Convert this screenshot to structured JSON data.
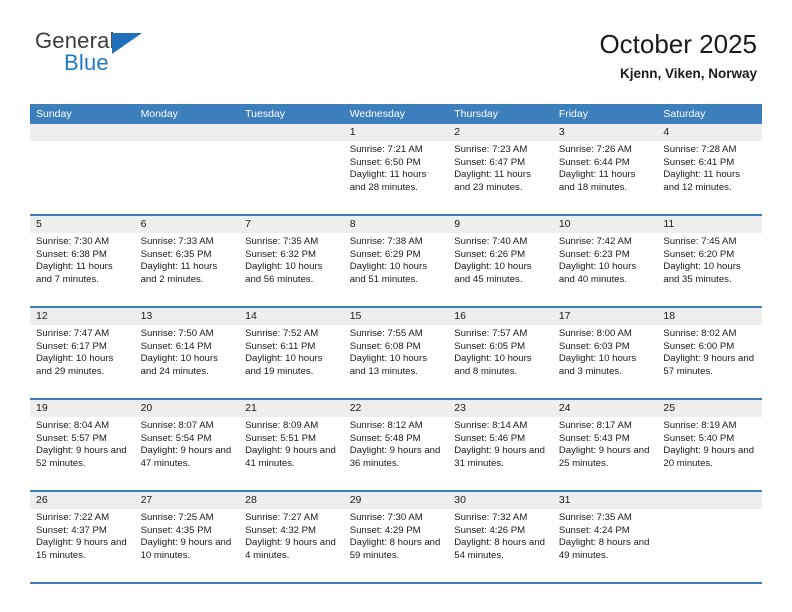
{
  "brand": {
    "name_top": "General",
    "name_bottom": "Blue",
    "triangle_color": "#1f6fbb",
    "top_color": "#3c3c3c",
    "bottom_color": "#1f7ac4"
  },
  "header": {
    "title": "October 2025",
    "location": "Kjenn, Viken, Norway"
  },
  "theme": {
    "header_blue": "#3d7ebd",
    "date_strip_gray": "#eeeeee",
    "text": "#1a1a1a",
    "background": "#ffffff"
  },
  "weekdays": [
    "Sunday",
    "Monday",
    "Tuesday",
    "Wednesday",
    "Thursday",
    "Friday",
    "Saturday"
  ],
  "weeks": [
    [
      {
        "day": "",
        "empty": true
      },
      {
        "day": "",
        "empty": true
      },
      {
        "day": "",
        "empty": true
      },
      {
        "day": "1",
        "sunrise": "Sunrise: 7:21 AM",
        "sunset": "Sunset: 6:50 PM",
        "daylight": "Daylight: 11 hours and 28 minutes."
      },
      {
        "day": "2",
        "sunrise": "Sunrise: 7:23 AM",
        "sunset": "Sunset: 6:47 PM",
        "daylight": "Daylight: 11 hours and 23 minutes."
      },
      {
        "day": "3",
        "sunrise": "Sunrise: 7:26 AM",
        "sunset": "Sunset: 6:44 PM",
        "daylight": "Daylight: 11 hours and 18 minutes."
      },
      {
        "day": "4",
        "sunrise": "Sunrise: 7:28 AM",
        "sunset": "Sunset: 6:41 PM",
        "daylight": "Daylight: 11 hours and 12 minutes."
      }
    ],
    [
      {
        "day": "5",
        "sunrise": "Sunrise: 7:30 AM",
        "sunset": "Sunset: 6:38 PM",
        "daylight": "Daylight: 11 hours and 7 minutes."
      },
      {
        "day": "6",
        "sunrise": "Sunrise: 7:33 AM",
        "sunset": "Sunset: 6:35 PM",
        "daylight": "Daylight: 11 hours and 2 minutes."
      },
      {
        "day": "7",
        "sunrise": "Sunrise: 7:35 AM",
        "sunset": "Sunset: 6:32 PM",
        "daylight": "Daylight: 10 hours and 56 minutes."
      },
      {
        "day": "8",
        "sunrise": "Sunrise: 7:38 AM",
        "sunset": "Sunset: 6:29 PM",
        "daylight": "Daylight: 10 hours and 51 minutes."
      },
      {
        "day": "9",
        "sunrise": "Sunrise: 7:40 AM",
        "sunset": "Sunset: 6:26 PM",
        "daylight": "Daylight: 10 hours and 45 minutes."
      },
      {
        "day": "10",
        "sunrise": "Sunrise: 7:42 AM",
        "sunset": "Sunset: 6:23 PM",
        "daylight": "Daylight: 10 hours and 40 minutes."
      },
      {
        "day": "11",
        "sunrise": "Sunrise: 7:45 AM",
        "sunset": "Sunset: 6:20 PM",
        "daylight": "Daylight: 10 hours and 35 minutes."
      }
    ],
    [
      {
        "day": "12",
        "sunrise": "Sunrise: 7:47 AM",
        "sunset": "Sunset: 6:17 PM",
        "daylight": "Daylight: 10 hours and 29 minutes."
      },
      {
        "day": "13",
        "sunrise": "Sunrise: 7:50 AM",
        "sunset": "Sunset: 6:14 PM",
        "daylight": "Daylight: 10 hours and 24 minutes."
      },
      {
        "day": "14",
        "sunrise": "Sunrise: 7:52 AM",
        "sunset": "Sunset: 6:11 PM",
        "daylight": "Daylight: 10 hours and 19 minutes."
      },
      {
        "day": "15",
        "sunrise": "Sunrise: 7:55 AM",
        "sunset": "Sunset: 6:08 PM",
        "daylight": "Daylight: 10 hours and 13 minutes."
      },
      {
        "day": "16",
        "sunrise": "Sunrise: 7:57 AM",
        "sunset": "Sunset: 6:05 PM",
        "daylight": "Daylight: 10 hours and 8 minutes."
      },
      {
        "day": "17",
        "sunrise": "Sunrise: 8:00 AM",
        "sunset": "Sunset: 6:03 PM",
        "daylight": "Daylight: 10 hours and 3 minutes."
      },
      {
        "day": "18",
        "sunrise": "Sunrise: 8:02 AM",
        "sunset": "Sunset: 6:00 PM",
        "daylight": "Daylight: 9 hours and 57 minutes."
      }
    ],
    [
      {
        "day": "19",
        "sunrise": "Sunrise: 8:04 AM",
        "sunset": "Sunset: 5:57 PM",
        "daylight": "Daylight: 9 hours and 52 minutes."
      },
      {
        "day": "20",
        "sunrise": "Sunrise: 8:07 AM",
        "sunset": "Sunset: 5:54 PM",
        "daylight": "Daylight: 9 hours and 47 minutes."
      },
      {
        "day": "21",
        "sunrise": "Sunrise: 8:09 AM",
        "sunset": "Sunset: 5:51 PM",
        "daylight": "Daylight: 9 hours and 41 minutes."
      },
      {
        "day": "22",
        "sunrise": "Sunrise: 8:12 AM",
        "sunset": "Sunset: 5:48 PM",
        "daylight": "Daylight: 9 hours and 36 minutes."
      },
      {
        "day": "23",
        "sunrise": "Sunrise: 8:14 AM",
        "sunset": "Sunset: 5:46 PM",
        "daylight": "Daylight: 9 hours and 31 minutes."
      },
      {
        "day": "24",
        "sunrise": "Sunrise: 8:17 AM",
        "sunset": "Sunset: 5:43 PM",
        "daylight": "Daylight: 9 hours and 25 minutes."
      },
      {
        "day": "25",
        "sunrise": "Sunrise: 8:19 AM",
        "sunset": "Sunset: 5:40 PM",
        "daylight": "Daylight: 9 hours and 20 minutes."
      }
    ],
    [
      {
        "day": "26",
        "sunrise": "Sunrise: 7:22 AM",
        "sunset": "Sunset: 4:37 PM",
        "daylight": "Daylight: 9 hours and 15 minutes."
      },
      {
        "day": "27",
        "sunrise": "Sunrise: 7:25 AM",
        "sunset": "Sunset: 4:35 PM",
        "daylight": "Daylight: 9 hours and 10 minutes."
      },
      {
        "day": "28",
        "sunrise": "Sunrise: 7:27 AM",
        "sunset": "Sunset: 4:32 PM",
        "daylight": "Daylight: 9 hours and 4 minutes."
      },
      {
        "day": "29",
        "sunrise": "Sunrise: 7:30 AM",
        "sunset": "Sunset: 4:29 PM",
        "daylight": "Daylight: 8 hours and 59 minutes."
      },
      {
        "day": "30",
        "sunrise": "Sunrise: 7:32 AM",
        "sunset": "Sunset: 4:26 PM",
        "daylight": "Daylight: 8 hours and 54 minutes."
      },
      {
        "day": "31",
        "sunrise": "Sunrise: 7:35 AM",
        "sunset": "Sunset: 4:24 PM",
        "daylight": "Daylight: 8 hours and 49 minutes."
      },
      {
        "day": "",
        "empty": true
      }
    ]
  ]
}
